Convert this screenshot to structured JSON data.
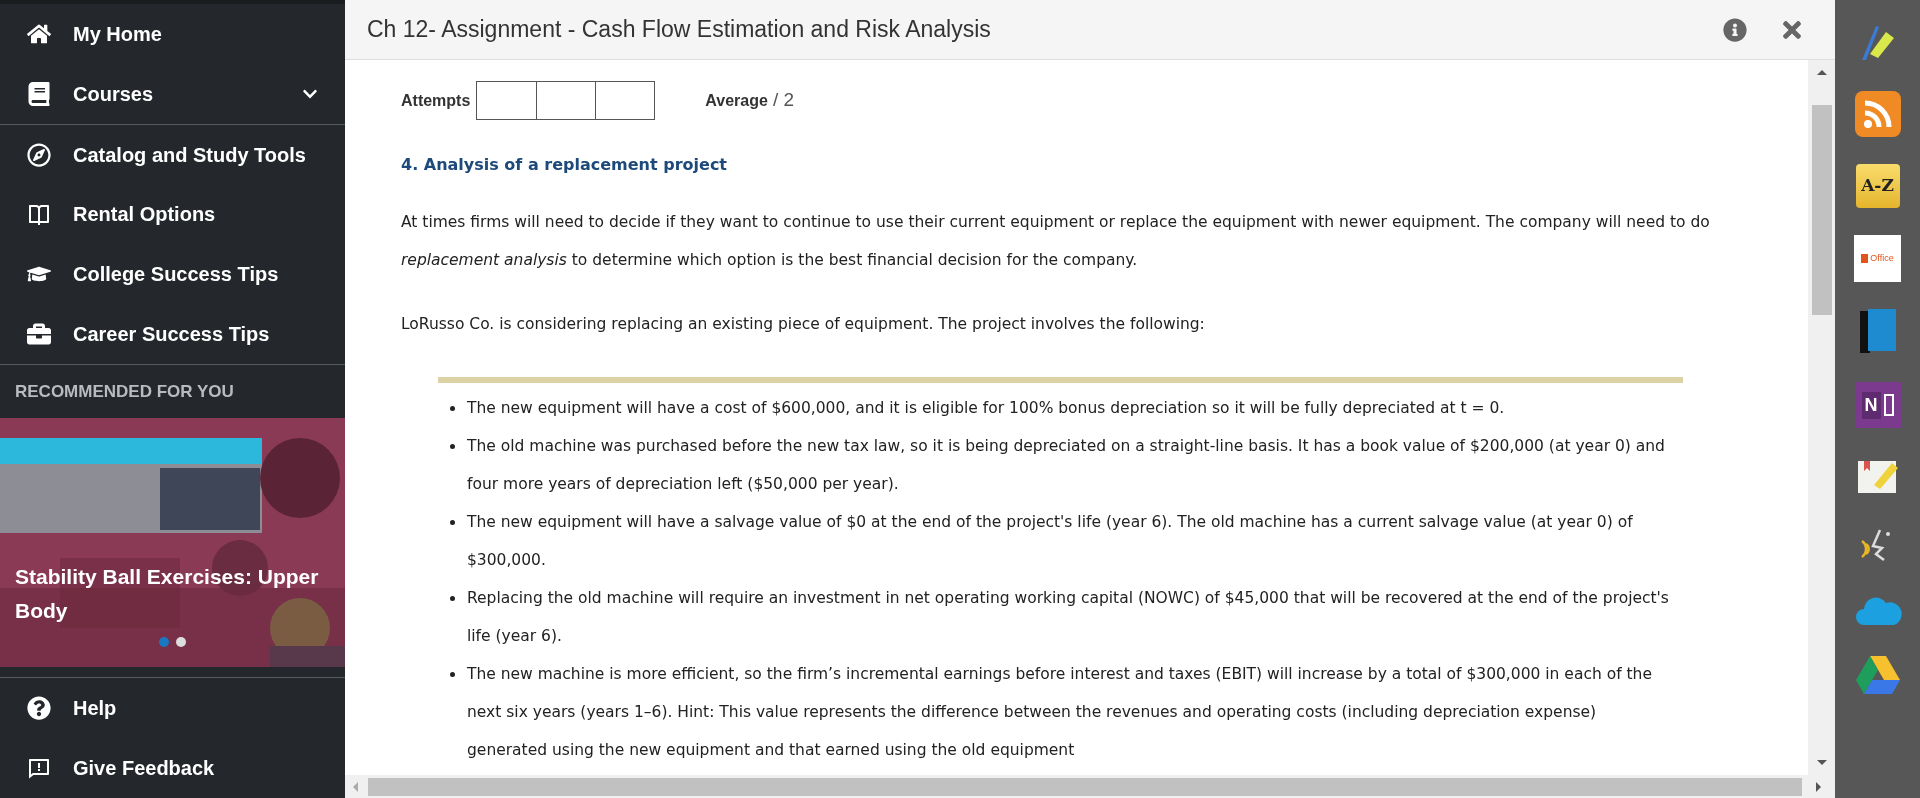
{
  "sidebar": {
    "items": [
      {
        "kind": "home",
        "label": "My Home",
        "expandable": false
      },
      {
        "kind": "courses",
        "label": "Courses",
        "expandable": true
      },
      {
        "kind": "compass",
        "label": "Catalog and Study Tools",
        "expandable": false
      },
      {
        "kind": "book-open",
        "label": "Rental Options",
        "expandable": false
      },
      {
        "kind": "cap",
        "label": "College Success Tips",
        "expandable": false
      },
      {
        "kind": "briefcase",
        "label": "Career Success Tips",
        "expandable": false
      }
    ],
    "recommended": {
      "heading": "RECOMMENDED FOR YOU",
      "card": {
        "kind": "picture",
        "title": "Stability Ball Exercises: Upper Body"
      },
      "dots": [
        {
          "selected": true
        },
        {
          "selected": false
        }
      ]
    },
    "footer_items": [
      {
        "kind": "help",
        "label": "Help"
      },
      {
        "kind": "feedback",
        "label": "Give Feedback"
      }
    ]
  },
  "window": {
    "title": "Ch 12- Assignment - Cash Flow Estimation and Risk Analysis"
  },
  "attempts": {
    "label": "Attempts",
    "average_label": "Average",
    "average_value": "/ 2"
  },
  "question": {
    "heading": "4. Analysis of a replacement project",
    "paragraphs": [
      "At times firms will need to decide if they want to continue to use their current equipment or replace the equipment with newer equipment. The company will need to do *replacement analysis* to determine which option is the best financial decision for the company.",
      "LoRusso Co. is considering replacing an existing piece of equipment. The project involves the following:"
    ],
    "bullets": [
      "The new equipment will have a cost of $600,000, and it is eligible for 100% bonus depreciation so it will be fully depreciated at t = 0.",
      "The old machine was purchased before the new tax law, so it is being depreciated on a straight-line basis. It has a book value of $200,000 (at year 0) and four more years of depreciation left ($50,000 per year).",
      "The new equipment will have a salvage value of $0 at the end of the project's life (year 6). The old machine has a current salvage value (at year 0) of $300,000.",
      "Replacing the old machine will require an investment in net operating working capital (NOWC) of $45,000 that will be recovered at the end of the project's life (year 6).",
      "The new machine is more efficient, so the firm’s incremental earnings before interest and taxes (EBIT) will increase by a total of $300,000 in each of the next six years (years 1–6). Hint: This value represents the difference between the revenues and operating costs (including depreciation expense) generated using the new equipment and that earned using the old equipment"
    ]
  },
  "tools": [
    {
      "kind": "pens"
    },
    {
      "kind": "rss"
    },
    {
      "kind": "dictionary",
      "label": "A-Z"
    },
    {
      "kind": "office",
      "label": "Office"
    },
    {
      "kind": "book"
    },
    {
      "kind": "notebook",
      "label": "N"
    },
    {
      "kind": "notes"
    },
    {
      "kind": "speech"
    },
    {
      "kind": "cloud"
    },
    {
      "kind": "drive"
    }
  ]
}
